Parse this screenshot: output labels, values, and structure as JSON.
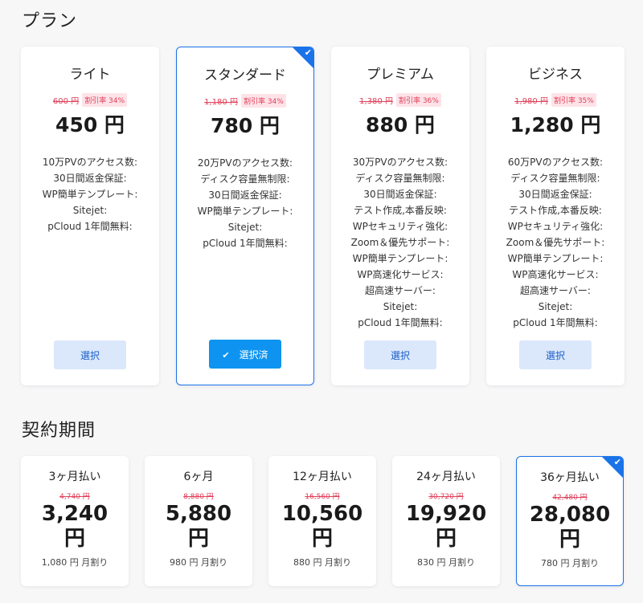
{
  "sections": {
    "plans_title": "プラン",
    "term_title": "契約期間"
  },
  "colors": {
    "accent": "#1a73e8",
    "button_active": "#0e94f0",
    "button_idle": "#dbe7fb",
    "discount": "#e0405a"
  },
  "plans": [
    {
      "name": "ライト",
      "old_price": "600 円",
      "discount": "割引率 34%",
      "price": "450 円",
      "features": [
        "10万PVのアクセス数:",
        "30日間返金保証:",
        "WP簡単テンプレート:",
        "Sitejet:",
        "pCloud 1年間無料:"
      ],
      "button_label": "選択",
      "selected": false
    },
    {
      "name": "スタンダード",
      "old_price": "1,180 円",
      "discount": "割引率 34%",
      "price": "780 円",
      "features": [
        "20万PVのアクセス数:",
        "ディスク容量無制限:",
        "30日間返金保証:",
        "WP簡単テンプレート:",
        "Sitejet:",
        "pCloud 1年間無料:"
      ],
      "button_label": "選択済",
      "selected": true
    },
    {
      "name": "プレミアム",
      "old_price": "1,380 円",
      "discount": "割引率 36%",
      "price": "880 円",
      "features": [
        "30万PVのアクセス数:",
        "ディスク容量無制限:",
        "30日間返金保証:",
        "テスト作成,本番反映:",
        "WPセキュリティ強化:",
        "Zoom＆優先サポート:",
        "WP簡単テンプレート:",
        "WP高速化サービス:",
        "超高速サーバー:",
        "Sitejet:",
        "pCloud 1年間無料:"
      ],
      "button_label": "選択",
      "selected": false
    },
    {
      "name": "ビジネス",
      "old_price": "1,980 円",
      "discount": "割引率 35%",
      "price": "1,280 円",
      "features": [
        "60万PVのアクセス数:",
        "ディスク容量無制限:",
        "30日間返金保証:",
        "テスト作成,本番反映:",
        "WPセキュリティ強化:",
        "Zoom＆優先サポート:",
        "WP簡単テンプレート:",
        "WP高速化サービス:",
        "超高速サーバー:",
        "Sitejet:",
        "pCloud 1年間無料:"
      ],
      "button_label": "選択",
      "selected": false
    }
  ],
  "terms": [
    {
      "name": "3ヶ月払い",
      "old_price": "4,740 円",
      "price": "3,240",
      "yen": "円",
      "monthly": "1,080 円 月割り",
      "selected": false
    },
    {
      "name": "6ヶ月",
      "old_price": "8,880 円",
      "price": "5,880",
      "yen": "円",
      "monthly": "980 円 月割り",
      "selected": false
    },
    {
      "name": "12ヶ月払い",
      "old_price": "16,560 円",
      "price": "10,560",
      "yen": "円",
      "monthly": "880 円 月割り",
      "selected": false
    },
    {
      "name": "24ヶ月払い",
      "old_price": "30,720 円",
      "price": "19,920",
      "yen": "円",
      "monthly": "830 円 月割り",
      "selected": false
    },
    {
      "name": "36ヶ月払い",
      "old_price": "42,480 円",
      "price": "28,080",
      "yen": "円",
      "monthly": "780 円 月割り",
      "selected": true
    }
  ]
}
